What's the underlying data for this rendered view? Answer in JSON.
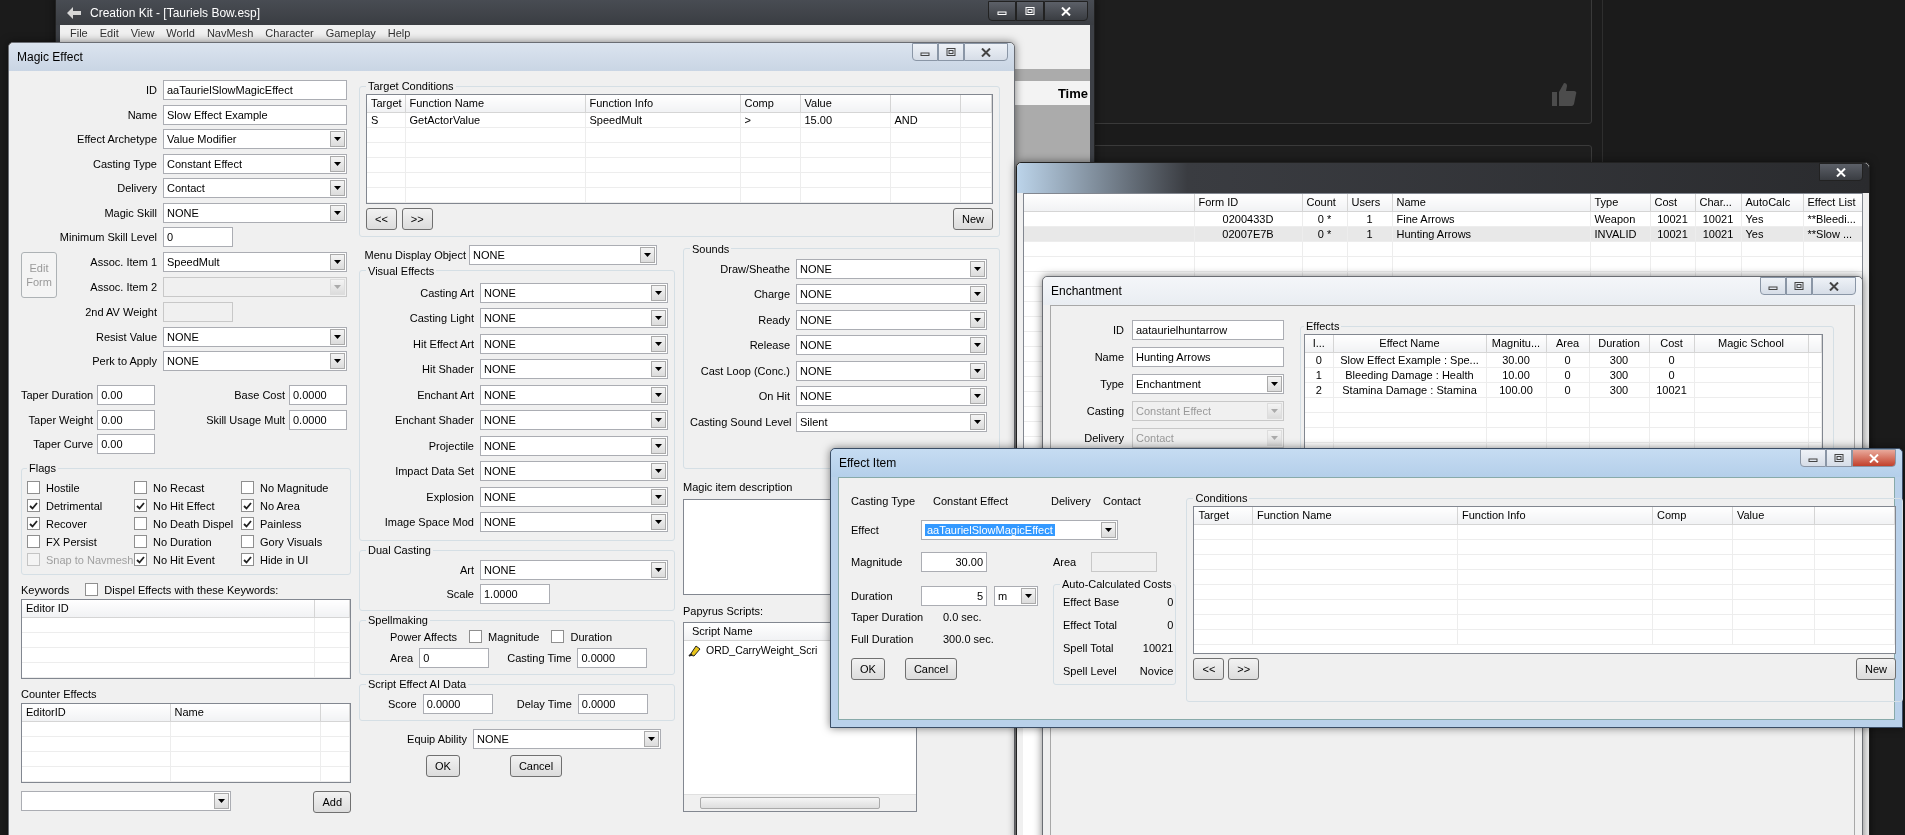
{
  "background_page": {
    "column_header": "Time"
  },
  "main_window": {
    "title": "Creation Kit - [Tauriels Bow.esp]",
    "menu": [
      "File",
      "Edit",
      "View",
      "World",
      "NavMesh",
      "Character",
      "Gameplay",
      "Help"
    ]
  },
  "magic_effect": {
    "title": "Magic Effect",
    "fields": [
      {
        "label": "ID",
        "kind": "text",
        "value": "aaTaurielSlowMagicEffect",
        "disabled": false
      },
      {
        "label": "Name",
        "kind": "text",
        "value": "Slow Effect Example",
        "disabled": false
      },
      {
        "label": "Effect Archetype",
        "kind": "combo",
        "value": "Value Modifier",
        "disabled": false
      },
      {
        "label": "Casting Type",
        "kind": "combo",
        "value": "Constant Effect",
        "disabled": false
      },
      {
        "label": "Delivery",
        "kind": "combo",
        "value": "Contact",
        "disabled": false
      },
      {
        "label": "Magic Skill",
        "kind": "combo",
        "value": "NONE",
        "disabled": false
      },
      {
        "label": "Minimum Skill Level",
        "kind": "number",
        "value": "0",
        "disabled": false
      },
      {
        "label": "Assoc. Item 1",
        "kind": "combo",
        "value": "SpeedMult",
        "disabled": false
      },
      {
        "label": "Assoc. Item 2",
        "kind": "combo",
        "disabled": true
      },
      {
        "label": "2nd AV Weight",
        "kind": "number",
        "disabled": true
      },
      {
        "label": "Resist Value",
        "kind": "combo",
        "value": "NONE",
        "disabled": false
      },
      {
        "label": "Perk to Apply",
        "kind": "combo",
        "value": "NONE",
        "disabled": false
      }
    ],
    "edit_form_button": {
      "label": "Edit Form",
      "disabled": true
    },
    "tapers": [
      {
        "label": "Taper Duration",
        "value": "0.00"
      },
      {
        "label": "Base Cost",
        "value": "0.0000"
      },
      {
        "label": "Taper Weight",
        "value": "0.00"
      },
      {
        "label": "Skill Usage Mult",
        "value": "0.0000"
      },
      {
        "label": "Taper Curve",
        "value": "0.00"
      }
    ],
    "flags": {
      "title": "Flags",
      "items": [
        {
          "label": "Hostile",
          "checked": false,
          "disabled": false
        },
        {
          "label": "No Recast",
          "checked": false,
          "disabled": false
        },
        {
          "label": "No Magnitude",
          "checked": false,
          "disabled": false
        },
        {
          "label": "Detrimental",
          "checked": true,
          "disabled": false
        },
        {
          "label": "No Hit Effect",
          "checked": true,
          "disabled": false
        },
        {
          "label": "No Area",
          "checked": true,
          "disabled": false
        },
        {
          "label": "Recover",
          "checked": true,
          "disabled": false
        },
        {
          "label": "No Death Dispel",
          "checked": false,
          "disabled": false
        },
        {
          "label": "Painless",
          "checked": true,
          "disabled": false
        },
        {
          "label": "FX Persist",
          "checked": false,
          "disabled": false
        },
        {
          "label": "No Duration",
          "checked": false,
          "disabled": false
        },
        {
          "label": "Gory Visuals",
          "checked": false,
          "disabled": false
        },
        {
          "label": "Snap to Navmesh",
          "checked": false,
          "disabled": true
        },
        {
          "label": "No Hit Event",
          "checked": true,
          "disabled": false
        },
        {
          "label": "Hide in UI",
          "checked": true,
          "disabled": false
        }
      ]
    },
    "keywords": {
      "title": "Keywords",
      "dispel": {
        "label": "Dispel Effects with these Keywords:",
        "checked": false
      },
      "columns": [
        "Editor ID"
      ]
    },
    "counter_effects": {
      "title": "Counter Effects",
      "columns": [
        "EditorID",
        "Name"
      ],
      "add_button": "Add"
    },
    "target_conditions": {
      "title": "Target Conditions",
      "columns": [
        "Target",
        "Function Name",
        "Function Info",
        "Comp",
        "Value"
      ],
      "rows": [
        [
          "S",
          "GetActorValue",
          "SpeedMult",
          ">",
          "15.00",
          "AND"
        ]
      ],
      "prev_button": "<<",
      "next_button": ">>",
      "new_button": "New"
    },
    "menu_display_object": {
      "label": "Menu Display Object",
      "value": "NONE"
    },
    "visual_effects": {
      "title": "Visual Effects",
      "fields": [
        {
          "label": "Casting Art",
          "value": "NONE"
        },
        {
          "label": "Casting Light",
          "value": "NONE"
        },
        {
          "label": "Hit Effect Art",
          "value": "NONE"
        },
        {
          "label": "Hit Shader",
          "value": "NONE"
        },
        {
          "label": "Enchant Art",
          "value": "NONE"
        },
        {
          "label": "Enchant Shader",
          "value": "NONE"
        },
        {
          "label": "Projectile",
          "value": "NONE"
        },
        {
          "label": "Impact Data Set",
          "value": "NONE"
        },
        {
          "label": "Explosion",
          "value": "NONE"
        },
        {
          "label": "Image Space Mod",
          "value": "NONE"
        }
      ]
    },
    "dual_casting": {
      "title": "Dual Casting",
      "art": {
        "label": "Art",
        "value": "NONE"
      },
      "scale": {
        "label": "Scale",
        "value": "1.0000"
      }
    },
    "spellmaking": {
      "title": "Spellmaking",
      "power_affects": "Power Affects",
      "options": [
        {
          "label": "Magnitude",
          "checked": false
        },
        {
          "label": "Duration",
          "checked": false
        }
      ],
      "area": {
        "label": "Area",
        "value": "0"
      },
      "casting_time": {
        "label": "Casting Time",
        "value": "0.0000"
      }
    },
    "script_effect_ai": {
      "title": "Script Effect AI Data",
      "score": {
        "label": "Score",
        "value": "0.0000"
      },
      "delay_time": {
        "label": "Delay Time",
        "value": "0.0000"
      }
    },
    "equip_ability": {
      "label": "Equip Ability",
      "value": "NONE"
    },
    "buttons": [
      "OK",
      "Cancel"
    ],
    "sounds": {
      "title": "Sounds",
      "fields": [
        {
          "label": "Draw/Sheathe",
          "value": "NONE"
        },
        {
          "label": "Charge",
          "value": "NONE"
        },
        {
          "label": "Ready",
          "value": "NONE"
        },
        {
          "label": "Release",
          "value": "NONE"
        },
        {
          "label": "Cast Loop (Conc.)",
          "value": "NONE"
        },
        {
          "label": "On Hit",
          "value": "NONE"
        },
        {
          "label": "Casting Sound Level",
          "value": "Silent"
        }
      ]
    },
    "description": {
      "label": "Magic item description"
    },
    "papyrus": {
      "label": "Papyrus Scripts:",
      "columns": [
        "Script Name"
      ],
      "rows": [
        "ORD_CarryWeight_Scri"
      ]
    }
  },
  "form_list": {
    "columns": [
      "Form ID",
      "Count",
      "Users",
      "Name",
      "Type",
      "Cost",
      "Char...",
      "AutoCalc",
      "Effect List"
    ],
    "rows": [
      {
        "cells": [
          "0200433D",
          "0 *",
          "1",
          "Fine Arrows",
          "Weapon",
          "10021",
          "10021",
          "Yes",
          "**Bleedi..."
        ],
        "selected": false
      },
      {
        "cells": [
          "02007E7B",
          "0 *",
          "1",
          "Hunting Arrows",
          "INVALID",
          "10021",
          "10021",
          "Yes",
          "**Slow ..."
        ],
        "selected": true
      }
    ]
  },
  "enchantment": {
    "title": "Enchantment",
    "fields": [
      {
        "label": "ID",
        "kind": "text",
        "value": "aataurielhuntarrow",
        "disabled": false
      },
      {
        "label": "Name",
        "kind": "text",
        "value": "Hunting Arrows",
        "disabled": false
      },
      {
        "label": "Type",
        "kind": "combo",
        "value": "Enchantment",
        "disabled": false
      },
      {
        "label": "Casting",
        "kind": "combo",
        "value": "Constant Effect",
        "disabled": true
      },
      {
        "label": "Delivery",
        "kind": "combo",
        "value": "Contact",
        "disabled": true
      }
    ],
    "effects": {
      "title": "Effects",
      "columns": [
        "I...",
        "Effect Name",
        "Magnitu...",
        "Area",
        "Duration",
        "Cost",
        "Magic School"
      ],
      "rows": [
        [
          "0",
          "Slow Effect Example : Spe...",
          "30.00",
          "0",
          "300",
          "0"
        ],
        [
          "1",
          "Bleeding Damage : Health",
          "10.00",
          "0",
          "300",
          "0"
        ],
        [
          "2",
          "Stamina Damage : Stamina",
          "100.00",
          "0",
          "300",
          "10021"
        ]
      ]
    }
  },
  "effect_item": {
    "title": "Effect Item",
    "casting_type": {
      "label": "Casting Type",
      "value": "Constant Effect"
    },
    "delivery": {
      "label": "Delivery",
      "value": "Contact"
    },
    "effect": {
      "label": "Effect",
      "value": "aaTaurielSlowMagicEffect"
    },
    "magnitude": {
      "label": "Magnitude",
      "value": "30.00"
    },
    "area": {
      "label": "Area"
    },
    "duration": {
      "label": "Duration",
      "value": "5",
      "unit": "m"
    },
    "taper_duration": {
      "label": "Taper Duration",
      "value": "0.0 sec."
    },
    "full_duration": {
      "label": "Full Duration",
      "value": "300.0 sec."
    },
    "costs": {
      "title": "Auto-Calculated Costs",
      "rows": [
        {
          "label": "Effect Base",
          "value": "0"
        },
        {
          "label": "Effect Total",
          "value": "0"
        },
        {
          "label": "Spell Total",
          "value": "10021"
        },
        {
          "label": "Spell Level",
          "value": "Novice"
        }
      ]
    },
    "buttons": [
      "OK",
      "Cancel"
    ],
    "conditions": {
      "title": "Conditions",
      "columns": [
        "Target",
        "Function Name",
        "Function Info",
        "Comp",
        "Value"
      ],
      "prev_button": "<<",
      "next_button": ">>",
      "new_button": "New"
    }
  }
}
